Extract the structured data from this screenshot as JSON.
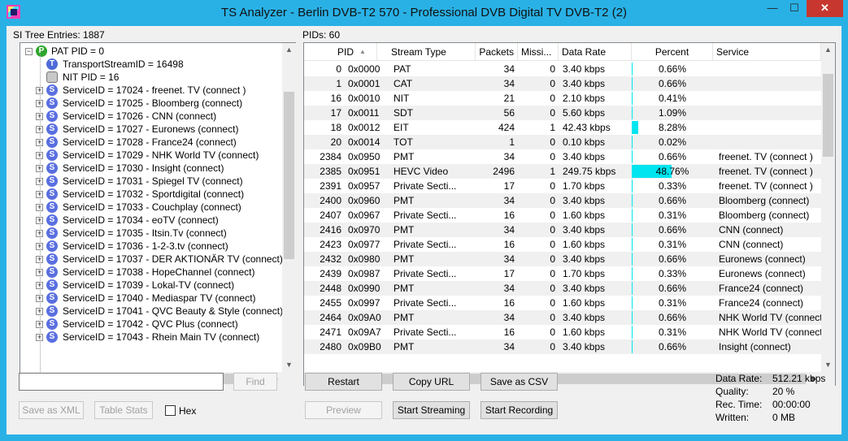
{
  "window": {
    "title": "TS Analyzer - Berlin DVB-T2 570 - Professional DVB Digital TV DVB-T2 (2)",
    "min_label": "—",
    "max_label": "☐",
    "close_label": "✕"
  },
  "tree": {
    "header": "SI Tree Entries: 1887",
    "root": "PAT PID = 0",
    "root_expander": "−",
    "children": [
      {
        "icon": "T",
        "label": "TransportStreamID = 16498"
      },
      {
        "icon": "",
        "label": "NIT PID = 16"
      }
    ],
    "services": [
      "ServiceID = 17024 - freenet. TV (connect )",
      "ServiceID = 17025 - Bloomberg (connect)",
      "ServiceID = 17026 - CNN (connect)",
      "ServiceID = 17027 - Euronews (connect)",
      "ServiceID = 17028 - France24 (connect)",
      "ServiceID = 17029 - NHK World TV (connect)",
      "ServiceID = 17030 - Insight (connect)",
      "ServiceID = 17031 - Spiegel TV (connect)",
      "ServiceID = 17032 - Sportdigital (connect)",
      "ServiceID = 17033 - Couchplay (connect)",
      "ServiceID = 17034 - eoTV (connect)",
      "ServiceID = 17035 - Itsin.Tv (connect)",
      "ServiceID = 17036 - 1-2-3.tv (connect)",
      "ServiceID = 17037 - DER AKTIONÄR TV (connect)",
      "ServiceID = 17038 - HopeChannel (connect)",
      "ServiceID = 17039 - Lokal-TV (connect)",
      "ServiceID = 17040 - Mediaspar TV (connect)",
      "ServiceID = 17041 - QVC Beauty & Style (connect)",
      "ServiceID = 17042 - QVC Plus (connect)",
      "ServiceID = 17043 - Rhein Main TV (connect)"
    ],
    "service_icon": "S",
    "expander": "+",
    "root_icon": "P"
  },
  "pids": {
    "header": "PIDs: 60",
    "sort_indicator": "▲",
    "columns": [
      "PID",
      "Stream Type",
      "Packets",
      "Missi...",
      "Data Rate",
      "Percent",
      "Service"
    ],
    "rows": [
      {
        "pid": "0",
        "hex": "0x0000",
        "type": "PAT",
        "packets": "34",
        "missing": "0",
        "rate": "3.40 kbps",
        "percent": "0.66%",
        "pct": 0.66,
        "service": ""
      },
      {
        "pid": "1",
        "hex": "0x0001",
        "type": "CAT",
        "packets": "34",
        "missing": "0",
        "rate": "3.40 kbps",
        "percent": "0.66%",
        "pct": 0.66,
        "service": ""
      },
      {
        "pid": "16",
        "hex": "0x0010",
        "type": "NIT",
        "packets": "21",
        "missing": "0",
        "rate": "2.10 kbps",
        "percent": "0.41%",
        "pct": 0.41,
        "service": ""
      },
      {
        "pid": "17",
        "hex": "0x0011",
        "type": "SDT",
        "packets": "56",
        "missing": "0",
        "rate": "5.60 kbps",
        "percent": "1.09%",
        "pct": 1.09,
        "service": ""
      },
      {
        "pid": "18",
        "hex": "0x0012",
        "type": "EIT",
        "packets": "424",
        "missing": "1",
        "rate": "42.43 kbps",
        "percent": "8.28%",
        "pct": 8.28,
        "service": ""
      },
      {
        "pid": "20",
        "hex": "0x0014",
        "type": "TOT",
        "packets": "1",
        "missing": "0",
        "rate": "0.10 kbps",
        "percent": "0.02%",
        "pct": 0.02,
        "service": ""
      },
      {
        "pid": "2384",
        "hex": "0x0950",
        "type": "PMT",
        "packets": "34",
        "missing": "0",
        "rate": "3.40 kbps",
        "percent": "0.66%",
        "pct": 0.66,
        "service": "freenet. TV (connect )"
      },
      {
        "pid": "2385",
        "hex": "0x0951",
        "type": "HEVC Video",
        "packets": "2496",
        "missing": "1",
        "rate": "249.75 kbps",
        "percent": "48.76%",
        "pct": 48.76,
        "service": "freenet. TV (connect )"
      },
      {
        "pid": "2391",
        "hex": "0x0957",
        "type": "Private Secti...",
        "packets": "17",
        "missing": "0",
        "rate": "1.70 kbps",
        "percent": "0.33%",
        "pct": 0.33,
        "service": "freenet. TV (connect )"
      },
      {
        "pid": "2400",
        "hex": "0x0960",
        "type": "PMT",
        "packets": "34",
        "missing": "0",
        "rate": "3.40 kbps",
        "percent": "0.66%",
        "pct": 0.66,
        "service": "Bloomberg (connect)"
      },
      {
        "pid": "2407",
        "hex": "0x0967",
        "type": "Private Secti...",
        "packets": "16",
        "missing": "0",
        "rate": "1.60 kbps",
        "percent": "0.31%",
        "pct": 0.31,
        "service": "Bloomberg (connect)"
      },
      {
        "pid": "2416",
        "hex": "0x0970",
        "type": "PMT",
        "packets": "34",
        "missing": "0",
        "rate": "3.40 kbps",
        "percent": "0.66%",
        "pct": 0.66,
        "service": "CNN (connect)"
      },
      {
        "pid": "2423",
        "hex": "0x0977",
        "type": "Private Secti...",
        "packets": "16",
        "missing": "0",
        "rate": "1.60 kbps",
        "percent": "0.31%",
        "pct": 0.31,
        "service": "CNN (connect)"
      },
      {
        "pid": "2432",
        "hex": "0x0980",
        "type": "PMT",
        "packets": "34",
        "missing": "0",
        "rate": "3.40 kbps",
        "percent": "0.66%",
        "pct": 0.66,
        "service": "Euronews (connect)"
      },
      {
        "pid": "2439",
        "hex": "0x0987",
        "type": "Private Secti...",
        "packets": "17",
        "missing": "0",
        "rate": "1.70 kbps",
        "percent": "0.33%",
        "pct": 0.33,
        "service": "Euronews (connect)"
      },
      {
        "pid": "2448",
        "hex": "0x0990",
        "type": "PMT",
        "packets": "34",
        "missing": "0",
        "rate": "3.40 kbps",
        "percent": "0.66%",
        "pct": 0.66,
        "service": "France24 (connect)"
      },
      {
        "pid": "2455",
        "hex": "0x0997",
        "type": "Private Secti...",
        "packets": "16",
        "missing": "0",
        "rate": "1.60 kbps",
        "percent": "0.31%",
        "pct": 0.31,
        "service": "France24 (connect)"
      },
      {
        "pid": "2464",
        "hex": "0x09A0",
        "type": "PMT",
        "packets": "34",
        "missing": "0",
        "rate": "3.40 kbps",
        "percent": "0.66%",
        "pct": 0.66,
        "service": "NHK World TV (connect)"
      },
      {
        "pid": "2471",
        "hex": "0x09A7",
        "type": "Private Secti...",
        "packets": "16",
        "missing": "0",
        "rate": "1.60 kbps",
        "percent": "0.31%",
        "pct": 0.31,
        "service": "NHK World TV (connect)"
      },
      {
        "pid": "2480",
        "hex": "0x09B0",
        "type": "PMT",
        "packets": "34",
        "missing": "0",
        "rate": "3.40 kbps",
        "percent": "0.66%",
        "pct": 0.66,
        "service": "Insight (connect)"
      }
    ]
  },
  "controls": {
    "search_value": "",
    "find": "Find",
    "save_xml": "Save as XML",
    "table_stats": "Table Stats",
    "hex": "Hex",
    "restart": "Restart",
    "copy_url": "Copy URL",
    "save_csv": "Save as CSV",
    "preview": "Preview",
    "start_streaming": "Start Streaming",
    "start_recording": "Start Recording"
  },
  "stats": {
    "data_rate_label": "Data Rate:",
    "data_rate": "512.21 kbps",
    "quality_label": "Quality:",
    "quality": "20 %",
    "rec_time_label": "Rec. Time:",
    "rec_time": "00:00:00",
    "written_label": "Written:",
    "written": "0 MB"
  },
  "scroll": {
    "up": "▲",
    "down": "▼",
    "left": "◀",
    "right": "▶"
  },
  "colors": {
    "percent_bar": "#00e5ef",
    "window_frame": "#29b1e6"
  }
}
